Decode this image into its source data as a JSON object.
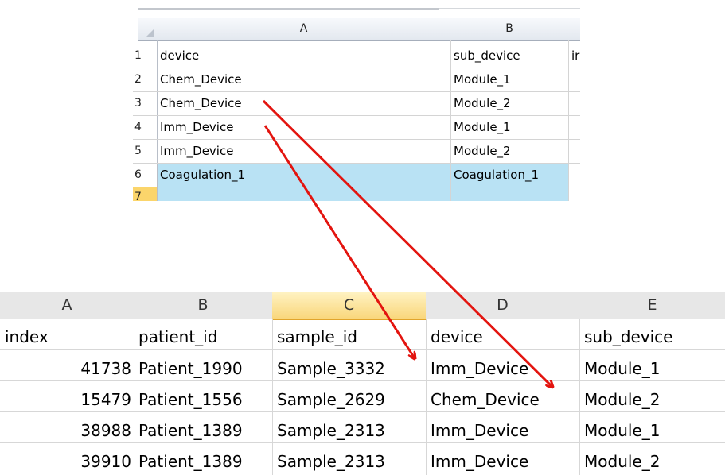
{
  "top_sheet": {
    "column_headers": [
      "A",
      "B"
    ],
    "row_numbers": [
      "1",
      "2",
      "3",
      "4",
      "5",
      "6",
      "7"
    ],
    "rows": [
      [
        "device",
        "sub_device",
        "ir"
      ],
      [
        "Chem_Device",
        "Module_1",
        ""
      ],
      [
        "Chem_Device",
        "Module_2",
        ""
      ],
      [
        "Imm_Device",
        "Module_1",
        ""
      ],
      [
        "Imm_Device",
        "Module_2",
        ""
      ],
      [
        "Coagulation_1",
        "Coagulation_1",
        ""
      ],
      [
        "",
        "",
        ""
      ]
    ],
    "selected_row": "6",
    "selection_color": "#b9e2f4"
  },
  "bottom_sheet": {
    "column_headers": [
      "A",
      "B",
      "C",
      "D",
      "E"
    ],
    "active_column": "C",
    "header_row": [
      "index",
      "patient_id",
      "sample_id",
      "device",
      "sub_device"
    ],
    "rows": [
      [
        "41738",
        "Patient_1990",
        "Sample_3332",
        "Imm_Device",
        "Module_1"
      ],
      [
        "15479",
        "Patient_1556",
        "Sample_2629",
        "Chem_Device",
        "Module_2"
      ],
      [
        "38988",
        "Patient_1389",
        "Sample_2313",
        "Imm_Device",
        "Module_1"
      ],
      [
        "39910",
        "Patient_1389",
        "Sample_2313",
        "Imm_Device",
        "Module_2"
      ]
    ]
  },
  "annotations": {
    "arrow_color": "#e3140f"
  }
}
